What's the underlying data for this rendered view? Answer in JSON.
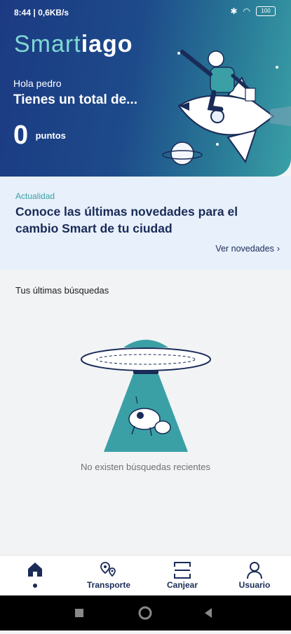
{
  "status_bar": {
    "time": "8:44",
    "speed": "0,6KB/s",
    "battery": "100"
  },
  "hero": {
    "logo_part1": "Smart",
    "logo_part2": "iago",
    "greeting": "Hola pedro",
    "total_text": "Tienes un total de...",
    "points_value": "0",
    "points_label": "puntos"
  },
  "news": {
    "tag": "Actualidad",
    "title": "Conoce las últimas novedades para el cambio Smart de tu ciudad",
    "link": "Ver novedades"
  },
  "searches": {
    "heading": "Tus últimas búsquedas",
    "empty_message": "No existen búsquedas recientes"
  },
  "bottom_nav": {
    "items": [
      {
        "label": "",
        "icon": "home-icon"
      },
      {
        "label": "Transporte",
        "icon": "route-pins-icon"
      },
      {
        "label": "Canjear",
        "icon": "scan-icon"
      },
      {
        "label": "Usuario",
        "icon": "user-icon"
      }
    ]
  },
  "colors": {
    "primary": "#1a2b57",
    "accent": "#3aa0a6",
    "news_bg": "#e7f0fb"
  }
}
